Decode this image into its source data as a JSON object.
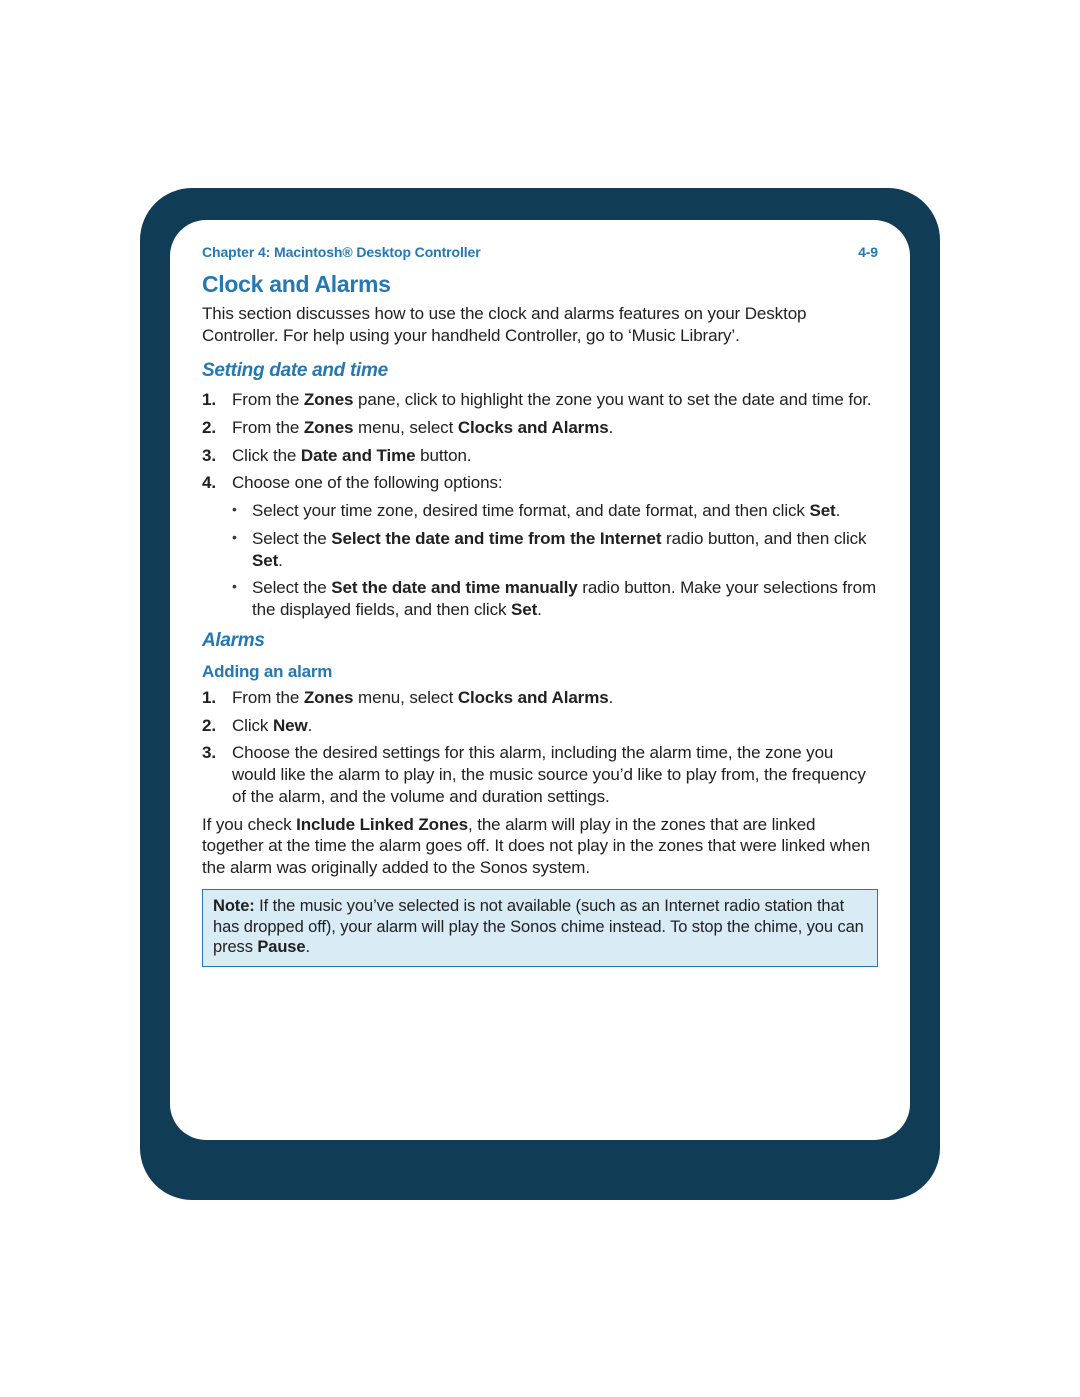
{
  "header": {
    "chapter": "Chapter 4:  Macintosh® Desktop Controller",
    "page": "4-9"
  },
  "title": "Clock and Alarms",
  "intro": {
    "t1": "This section discusses how to use the clock and alarms features on your Desktop Controller. For help using your handheld Controller, go to ‘Music Library’."
  },
  "section1": {
    "heading": "Setting date and time",
    "steps": {
      "s1": {
        "num": "1.",
        "pre": "From the ",
        "b1": "Zones",
        "post": " pane, click to highlight the zone you want to set the date and time for."
      },
      "s2": {
        "num": "2.",
        "pre": "From the ",
        "b1": "Zones",
        "mid": " menu, select ",
        "b2": "Clocks and Alarms",
        "post": "."
      },
      "s3": {
        "num": "3.",
        "pre": "Click the ",
        "b1": "Date and Time",
        "post": " button."
      },
      "s4": {
        "num": "4.",
        "text": "Choose one of the following options:"
      }
    },
    "bullets": {
      "b1": {
        "pre": "Select your time zone, desired time format, and date format, and then click ",
        "bold": "Set",
        "post": "."
      },
      "b2": {
        "pre": "Select the ",
        "bold": "Select the date and time from the Internet",
        "mid": " radio button, and then click ",
        "bold2": "Set",
        "post": "."
      },
      "b3": {
        "pre": "Select the ",
        "bold": "Set the date and time manually",
        "mid": " radio button. Make your selections from the displayed fields, and then click ",
        "bold2": "Set",
        "post": "."
      }
    }
  },
  "section2": {
    "heading": "Alarms",
    "sub": "Adding an alarm",
    "steps": {
      "s1": {
        "num": "1.",
        "pre": "From the ",
        "b1": "Zones",
        "mid": " menu, select ",
        "b2": "Clocks and Alarms",
        "post": "."
      },
      "s2": {
        "num": "2.",
        "pre": "Click ",
        "b1": "New",
        "post": "."
      },
      "s3": {
        "num": "3.",
        "text": "Choose the desired settings for this alarm, including the alarm time, the zone you would like the alarm to play in, the music source you’d like to play from, the frequency of the alarm, and the volume and duration settings."
      }
    },
    "para": {
      "pre": "If you check ",
      "bold": "Include Linked Zones",
      "post": ", the alarm will play in the zones that are linked together at the time the alarm goes off. It does not play in the zones that were linked when the alarm was originally added to the Sonos system."
    }
  },
  "note": {
    "label": "Note:   ",
    "t1": "If the music you’ve selected is not available (such as an Internet radio station that has dropped off), your alarm will play the Sonos chime instead. To stop the chime, you can press ",
    "bold": "Pause",
    "post": "."
  }
}
